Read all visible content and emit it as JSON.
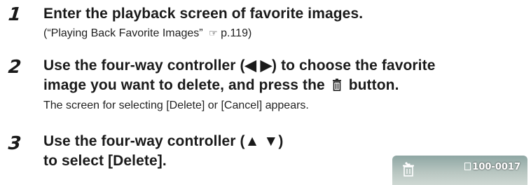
{
  "steps": [
    {
      "number": "1",
      "heading": "Enter the playback screen of favorite images.",
      "note_open": "(“Playing Back Favorite Images”",
      "note_ref_icon": "pointing-hand-icon",
      "note_ref": "p.119)"
    },
    {
      "number": "2",
      "heading_line1": "Use the four-way controller (◀ ▶) to choose the favorite",
      "heading_line2_start": "image you want to delete, and press the",
      "heading_line2_icon": "trash-icon",
      "heading_line2_end": "button.",
      "body": "The screen for selecting [Delete] or [Cancel] appears."
    },
    {
      "number": "3",
      "heading_line1": "Use the four-way controller (▲ ▼)",
      "heading_line2": "to select [Delete]."
    }
  ],
  "screen_preview": {
    "icon": "favorite-delete-icon",
    "file_number": "100-0017",
    "colors": {
      "sky": "#9fb3b0",
      "text": "#ffffff"
    }
  }
}
